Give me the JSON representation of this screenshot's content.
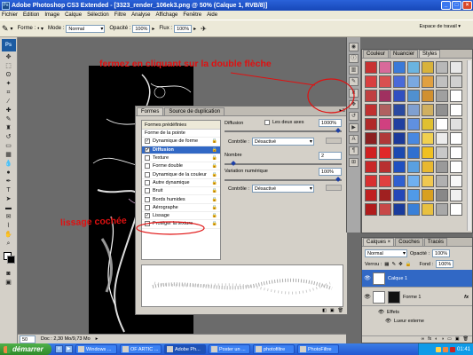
{
  "window": {
    "title": "Adobe Photoshop CS3 Extended - [3323_render_106ek3.png @ 50% (Calque 1, RVB/8)]",
    "app_icon": "Ps"
  },
  "menu": [
    "Fichier",
    "Edition",
    "Image",
    "Calque",
    "Sélection",
    "Filtre",
    "Analyse",
    "Affichage",
    "Fenêtre",
    "Aide"
  ],
  "options_bar": {
    "forme_label": "Forme :",
    "mode_label": "Mode :",
    "mode_value": "Normal",
    "opacite_label": "Opacité :",
    "opacite_value": "100%",
    "flux_label": "Flux :",
    "flux_value": "100%",
    "workspace_label": "Espace de travail ▾"
  },
  "annotations": {
    "fermez": "fermez en cliquant sur la double flèche",
    "lissage": "lissage cochée"
  },
  "brush_panel": {
    "tabs": [
      "Formes",
      "Source de duplication"
    ],
    "left_header": "Formes prédéfinies",
    "items": [
      {
        "label": "Forme de la pointe",
        "check": "",
        "lock": false,
        "selected": false
      },
      {
        "label": "Dynamique de forme",
        "check": "✓",
        "lock": true,
        "selected": false
      },
      {
        "label": "Diffusion",
        "check": "✓",
        "lock": true,
        "selected": true
      },
      {
        "label": "Texture",
        "check": "",
        "lock": true,
        "selected": false
      },
      {
        "label": "Forme double",
        "check": "",
        "lock": true,
        "selected": false
      },
      {
        "label": "Dynamique de la couleur",
        "check": "",
        "lock": true,
        "selected": false
      },
      {
        "label": "Autre dynamique",
        "check": "",
        "lock": true,
        "selected": false
      },
      {
        "label": "Bruit",
        "check": "",
        "lock": true,
        "selected": false
      },
      {
        "label": "Bords humides",
        "check": "",
        "lock": true,
        "selected": false
      },
      {
        "label": "Aérographe",
        "check": "",
        "lock": true,
        "selected": false
      },
      {
        "label": "Lissage",
        "check": "✓",
        "lock": true,
        "selected": false
      },
      {
        "label": "Protéger la texture",
        "check": "",
        "lock": true,
        "selected": false
      }
    ],
    "diffusion_label": "Diffusion",
    "deux_axes_label": "Les deux axes",
    "diffusion_value": "1000%",
    "controle_label": "Contrôle :",
    "controle_value": "Désactivé",
    "nombre_label": "Nombre",
    "nombre_value": "2",
    "variation_label": "Variation numérique",
    "variation_value": "100%",
    "controle2_label": "Contrôle :",
    "controle2_value": "Désactivé"
  },
  "styles_panel": {
    "tabs": [
      "Couleur",
      "Nuancier",
      "Styles"
    ],
    "swatches": [
      "#c83232",
      "#d86a9a",
      "#3a7ad8",
      "#6ab4e0",
      "#d8b23a",
      "#b8b8b8",
      "#e8e8e8",
      "#d84040",
      "#d85050",
      "#4a6ad8",
      "#7aa8e0",
      "#e0a040",
      "#c0c0c0",
      "#d0d0d0",
      "#c04040",
      "#a03060",
      "#3050c0",
      "#5090d0",
      "#d09030",
      "#a0a0a0",
      "#ffffff",
      "#c03030",
      "#b06060",
      "#2a4aa0",
      "#80a0d0",
      "#d0b060",
      "#909090",
      "#ffffff",
      "#b02828",
      "#d04080",
      "#2040a0",
      "#6090e0",
      "#e0c030",
      "#ffffff",
      "#e0e0e0",
      "#8b2020",
      "#b03838",
      "#1c3a9a",
      "#4888e0",
      "#f0d050",
      "#ececec",
      "#ffffff",
      "#d02020",
      "#e02828",
      "#1c4ab0",
      "#3070d0",
      "#f0c020",
      "#c8c8c8",
      "#ffffff",
      "#c82828",
      "#b83030",
      "#2050c0",
      "#5aa0e0",
      "#e8b830",
      "#9a9a9a",
      "#ffffff",
      "#d83030",
      "#e04040",
      "#3060d0",
      "#70b0f0",
      "#f0c850",
      "#b0b0b0",
      "#f8f8f8",
      "#c02020",
      "#a02020",
      "#2448b8",
      "#509ae8",
      "#d8a020",
      "#888888",
      "#f0f0f0",
      "#b01c1c",
      "#c84848",
      "#1a3c9c",
      "#3a80d8",
      "#e8c040",
      "#a8a8a8",
      "#ffffff"
    ]
  },
  "layers_panel": {
    "tabs": [
      "Calques ×",
      "Couches",
      "Tracés"
    ],
    "blend_mode": "Normal",
    "opacite_label": "Opacité :",
    "opacite_value": "100%",
    "verrou_label": "Verrou :",
    "fond_label": "Fond :",
    "fond_value": "100%",
    "layers": [
      {
        "name": "Calque 1",
        "selected": true,
        "dark": false
      },
      {
        "name": "Forme 1",
        "selected": false,
        "dark": false
      }
    ],
    "effets_label": "Effets",
    "lueur_label": "Lueur externe"
  },
  "status": {
    "zoom": "50 %",
    "doc": "Doc : 2,30 Mo/9,73 Mo"
  },
  "taskbar": {
    "start_label": "démarrer",
    "tasks": [
      "Windows ...",
      "OF ARTIC ...",
      "Adobe Ph...",
      "Poster un ...",
      "photofiltre",
      "PhotoFiltre"
    ],
    "clock": "01:41"
  }
}
